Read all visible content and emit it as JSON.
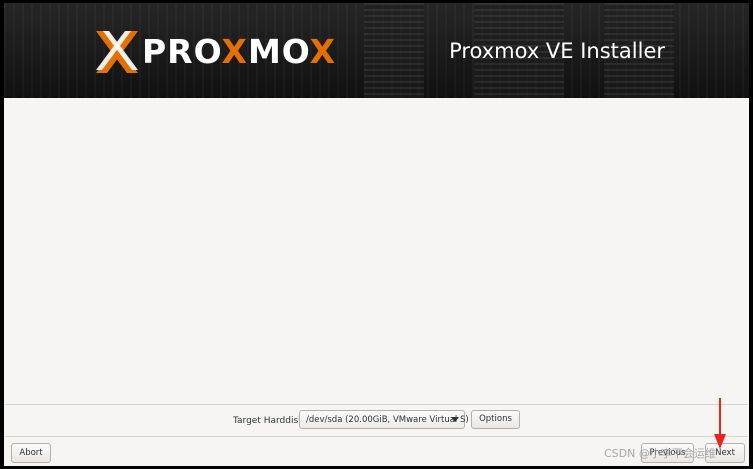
{
  "header": {
    "logo_prefix": "PRO",
    "logo_x": "X",
    "logo_mid": "MO",
    "logo_x2": "X",
    "title": "Proxmox VE Installer",
    "brand_orange": "#e57000"
  },
  "disk_selection": {
    "label": "Target Harddisk",
    "selected_disk": "/dev/sda (20.00GiB, VMware Virtual S)",
    "options_button": "Options"
  },
  "navigation": {
    "abort": "Abort",
    "previous": "Previous",
    "next": "Next"
  },
  "overlay": {
    "watermark": "CSDN @小李不会运维",
    "annotation_color": "#e8231c"
  }
}
